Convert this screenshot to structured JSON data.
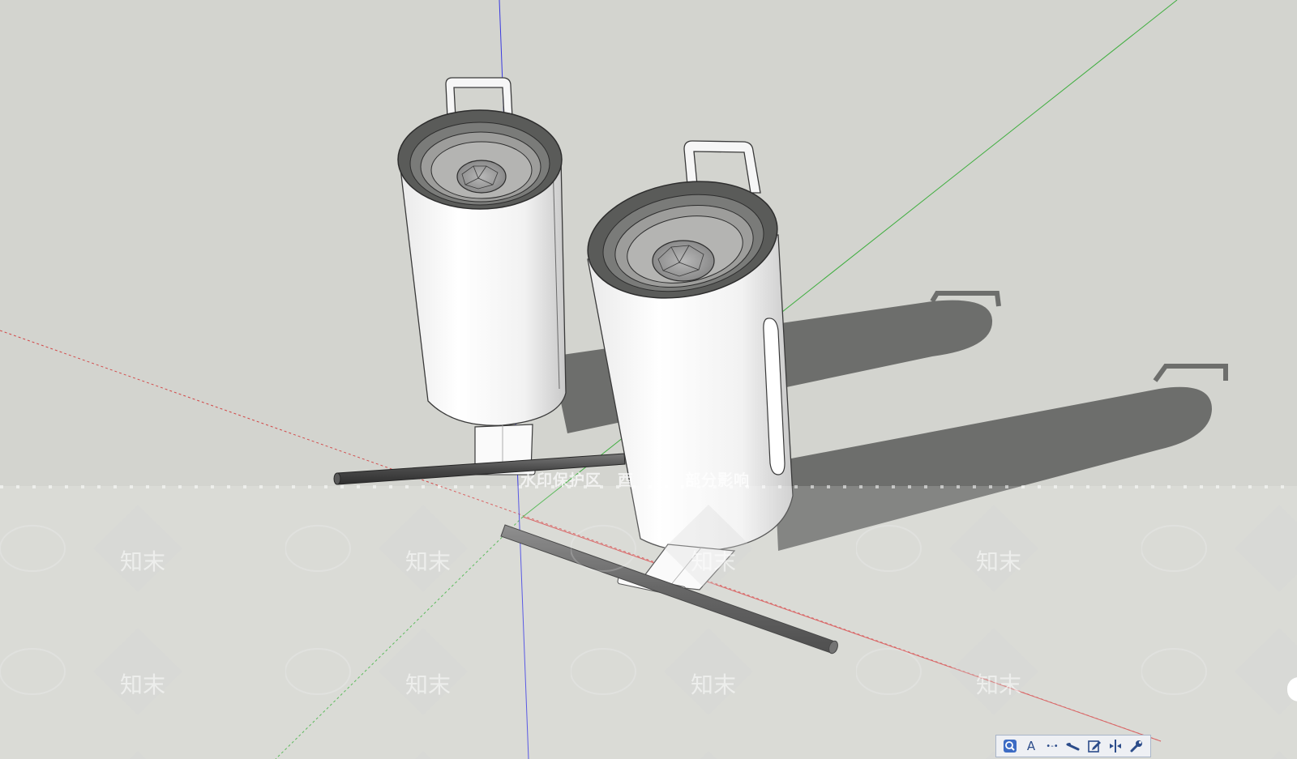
{
  "viewport": {
    "background": "#d3d4cf"
  },
  "axes": {
    "red": "#d24a4a",
    "green": "#3fae3f",
    "blue": "#3a3adf"
  },
  "watermark": {
    "caption_a": "水印保护区",
    "caption_b": "酉",
    "caption_c": "部分影响",
    "logo_text": "知末"
  },
  "toolbar": {
    "buttons": [
      {
        "name": "zoom",
        "icon": "magnifier-icon"
      },
      {
        "name": "text",
        "icon": "text-a-icon",
        "label": "A"
      },
      {
        "name": "dimension",
        "icon": "dimension-icon",
        "label": "•‐•"
      },
      {
        "name": "tape",
        "icon": "tape-measure-icon"
      },
      {
        "name": "edit",
        "icon": "edit-icon"
      },
      {
        "name": "section",
        "icon": "section-plane-icon"
      },
      {
        "name": "settings",
        "icon": "wrench-icon"
      }
    ]
  }
}
